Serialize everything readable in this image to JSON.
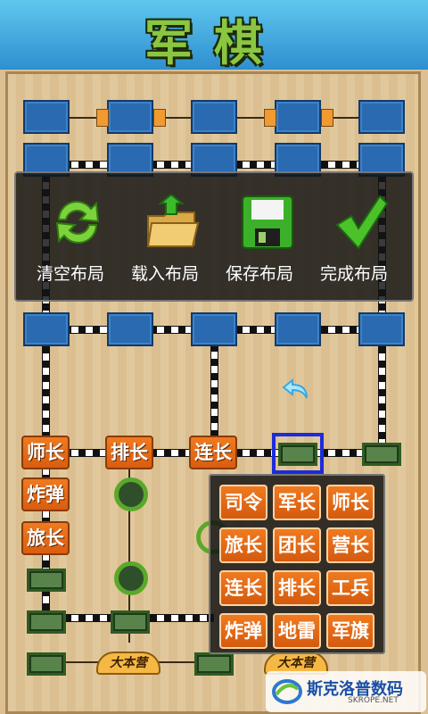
{
  "header": {
    "title": "军棋"
  },
  "menu": {
    "items": [
      {
        "label": "清空布局",
        "icon": "refresh-icon"
      },
      {
        "label": "载入布局",
        "icon": "folder-load-icon"
      },
      {
        "label": "保存布局",
        "icon": "floppy-save-icon"
      },
      {
        "label": "完成布局",
        "icon": "checkmark-icon"
      }
    ]
  },
  "board": {
    "placed_pieces": [
      "师长",
      "排长",
      "连长",
      "炸弹",
      "旅长"
    ],
    "headquarters": [
      "大本营",
      "大本营"
    ]
  },
  "picker": {
    "pieces": [
      "司令",
      "军长",
      "师长",
      "旅长",
      "团长",
      "营长",
      "连长",
      "排长",
      "工兵",
      "炸弹",
      "地雷",
      "军旗"
    ]
  },
  "brand": {
    "name": "斯克洛普数码",
    "sub": "SKROPE.NET"
  },
  "colors": {
    "piece": "#e06a18",
    "enemy": "#2a6ab0",
    "camp": "#5aa82a",
    "selection": "#1c2cd8"
  }
}
